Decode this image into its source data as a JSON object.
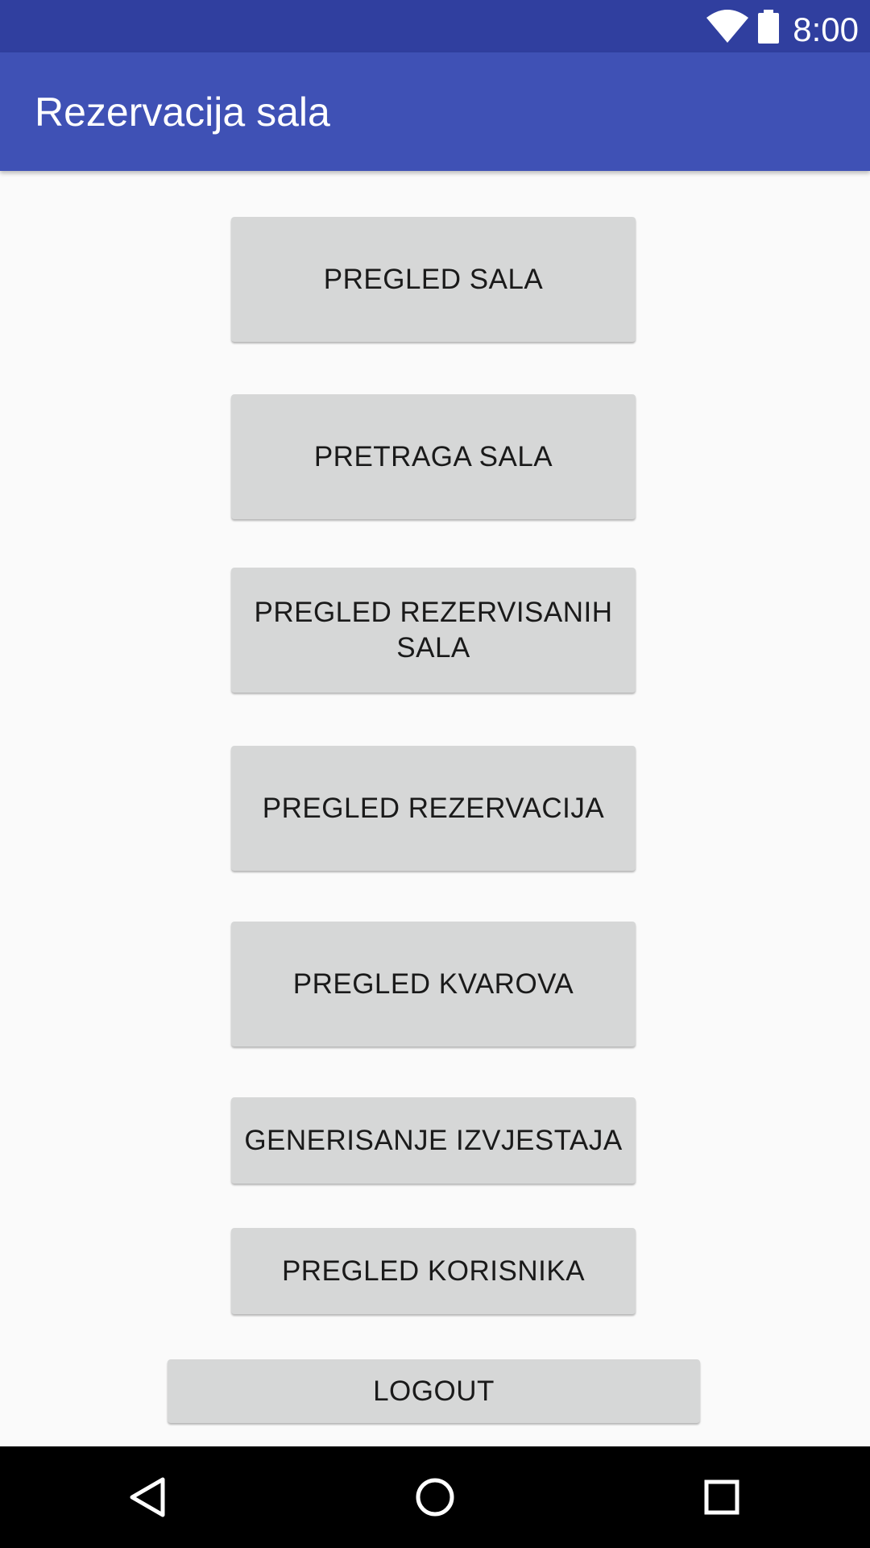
{
  "status_bar": {
    "time": "8:00",
    "icons": [
      "wifi-icon",
      "battery-icon"
    ]
  },
  "app_bar": {
    "title": "Rezervacija sala",
    "color": "#3f51b5",
    "status_color": "#303f9f"
  },
  "menu": {
    "buttons": [
      {
        "label": "PREGLED SALA"
      },
      {
        "label": "PRETRAGA SALA"
      },
      {
        "label": "PREGLED REZERVISANIH SALA"
      },
      {
        "label": "PREGLED REZERVACIJA"
      },
      {
        "label": "PREGLED KVAROVA"
      },
      {
        "label": "GENERISANJE IZVJESTAJA"
      },
      {
        "label": "PREGLED KORISNIKA"
      }
    ],
    "logout_label": "LOGOUT"
  },
  "nav_bar": {
    "icons": [
      "back-icon",
      "home-icon",
      "recent-apps-icon"
    ]
  }
}
